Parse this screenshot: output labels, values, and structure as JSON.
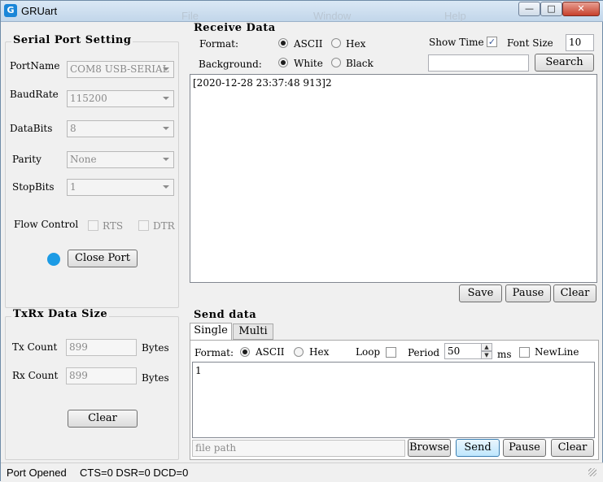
{
  "window": {
    "title": "GRUart",
    "ghost_menu": [
      "File",
      "Window",
      "Help"
    ],
    "controls": {
      "minimize": "—",
      "maximize": "□",
      "close": "✕"
    }
  },
  "serial": {
    "title": "Serial Port Setting",
    "port": {
      "label": "PortName",
      "value": "COM8 USB-SERIAL"
    },
    "baud": {
      "label": "BaudRate",
      "value": "115200"
    },
    "databits": {
      "label": "DataBits",
      "value": "8"
    },
    "parity": {
      "label": "Parity",
      "value": "None"
    },
    "stopbits": {
      "label": "StopBits",
      "value": "1"
    },
    "flow_label": "Flow Control",
    "rts_label": "RTS",
    "dtr_label": "DTR",
    "led_color": "#1c9be5",
    "close_port_label": "Close Port"
  },
  "txrx": {
    "title": "TxRx Data Size",
    "tx_label": "Tx Count",
    "tx_value": "899",
    "tx_unit": "Bytes",
    "rx_label": "Rx Count",
    "rx_value": "899",
    "rx_unit": "Bytes",
    "clear_label": "Clear"
  },
  "receive": {
    "title": "Receive Data",
    "format_label": "Format:",
    "ascii_label": "ASCII",
    "hex_label": "Hex",
    "background_label": "Background:",
    "white_label": "White",
    "black_label": "Black",
    "show_time_label": "Show Time",
    "show_time_checked": "✓",
    "font_size_label": "Font Size",
    "font_size_value": "10",
    "search_value": "",
    "search_label": "Search",
    "content": "[2020-12-28 23:37:48 913]2",
    "save_label": "Save",
    "pause_label": "Pause",
    "clear_label": "Clear"
  },
  "send": {
    "title": "Send data",
    "tab_single": "Single",
    "tab_multi": "Multi",
    "format_label": "Format:",
    "ascii_label": "ASCII",
    "hex_label": "Hex",
    "loop_label": "Loop",
    "period_label": "Period",
    "period_value": "50",
    "period_unit": "ms",
    "newline_label": "NewLine",
    "content": "1",
    "file_path_placeholder": "file path",
    "browse_label": "Browse",
    "send_label": "Send",
    "pause_label": "Pause",
    "clear_label": "Clear"
  },
  "status": {
    "port_state": "Port Opened",
    "signals": "CTS=0 DSR=0 DCD=0"
  }
}
